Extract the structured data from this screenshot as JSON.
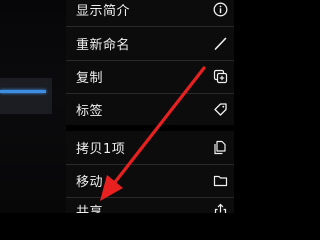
{
  "menu": {
    "items": [
      {
        "label": "显示简介",
        "icon": "info-icon"
      },
      {
        "label": "重新命名",
        "icon": "pencil-icon"
      },
      {
        "label": "复制",
        "icon": "duplicate-icon"
      },
      {
        "label": "标签",
        "icon": "tag-icon"
      },
      {
        "label": "拷贝1项",
        "icon": "copy-document-icon"
      },
      {
        "label": "移动",
        "icon": "folder-icon"
      },
      {
        "label": "共享",
        "icon": "share-icon"
      }
    ]
  },
  "colors": {
    "menu_background": "#0c0c0d",
    "text": "#f0f0f0",
    "annotation_arrow": "#e82020",
    "thumbnail_accent": "#3d8ee0"
  }
}
